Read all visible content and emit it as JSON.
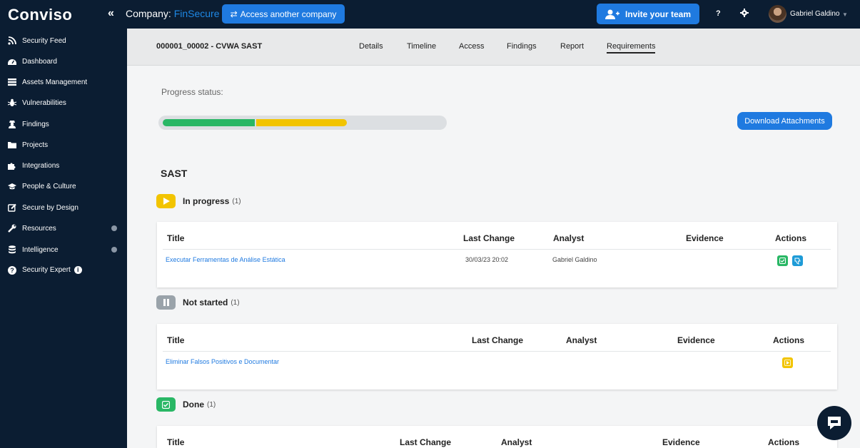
{
  "topbar": {
    "logo": "Conviso",
    "company_label": "Company:",
    "company_name": "FinSecure",
    "access_label": "Access another company",
    "invite_label": "Invite your team",
    "help": "?",
    "user_name": "Gabriel Galdino"
  },
  "sidebar": {
    "items": [
      {
        "label": "Security Feed",
        "icon": "rss-icon"
      },
      {
        "label": "Dashboard",
        "icon": "dashboard-icon"
      },
      {
        "label": "Assets Management",
        "icon": "list-icon"
      },
      {
        "label": "Vulnerabilities",
        "icon": "bug-icon"
      },
      {
        "label": "Findings",
        "icon": "user-secret-icon"
      },
      {
        "label": "Projects",
        "icon": "folder-icon"
      },
      {
        "label": "Integrations",
        "icon": "puzzle-icon"
      },
      {
        "label": "People & Culture",
        "icon": "graduation-cap-icon"
      },
      {
        "label": "Secure by Design",
        "icon": "edit-icon"
      },
      {
        "label": "Resources",
        "icon": "wrench-icon"
      },
      {
        "label": "Intelligence",
        "icon": "database-icon"
      },
      {
        "label": "Security Expert",
        "icon": "question-circle-icon"
      }
    ]
  },
  "header": {
    "project_title": "000001_00002 - CVWA SAST",
    "tabs": [
      "Details",
      "Timeline",
      "Access",
      "Findings",
      "Report",
      "Requirements"
    ],
    "active_tab": "Requirements"
  },
  "progress": {
    "label": "Progress status:",
    "done_fraction": 0.33,
    "in_progress_fraction": 0.33,
    "colors": {
      "done": "#29b765",
      "in_progress": "#f2c400",
      "track": "#dcdfe2"
    }
  },
  "download_label": "Download Attachments",
  "section_title": "SAST",
  "columns": {
    "title": "Title",
    "last_change": "Last Change",
    "analyst": "Analyst",
    "evidence": "Evidence",
    "actions": "Actions"
  },
  "groups": {
    "in_progress": {
      "label": "In progress",
      "count": "(1)",
      "rows": [
        {
          "title": "Executar Ferramentas de Análise Estática",
          "last_change": "30/03/23 20:02",
          "analyst": "Gabriel Galdino",
          "evidence": ""
        }
      ]
    },
    "not_started": {
      "label": "Not started",
      "count": "(1)",
      "rows": [
        {
          "title": "Eliminar Falsos Positivos e Documentar",
          "last_change": "",
          "analyst": "",
          "evidence": ""
        }
      ]
    },
    "done": {
      "label": "Done",
      "count": "(1)"
    }
  },
  "colors": {
    "navy": "#0b1d32",
    "accent_blue": "#1f7ae0",
    "yellow": "#f2c400",
    "green": "#29b765",
    "grey": "#9aa3aa"
  }
}
